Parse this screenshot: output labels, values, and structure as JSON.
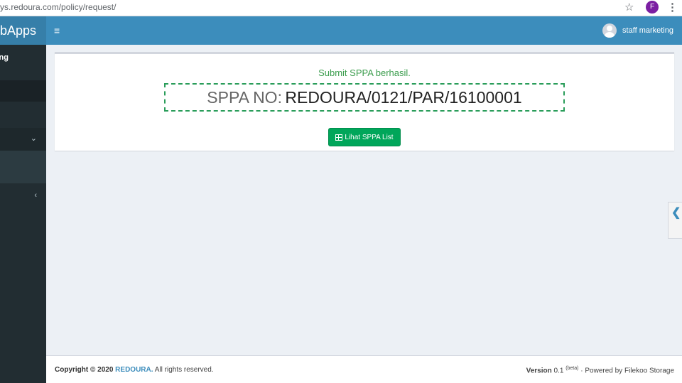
{
  "browser": {
    "url": "ys.redoura.com/policy/request/",
    "star_icon": "☆",
    "profile_initial": "F",
    "menu_icon": "⋮"
  },
  "sidebar": {
    "logo": "ebApps",
    "user_label": "ng",
    "expand_chevron": "⌄",
    "collapse_chevron": "‹"
  },
  "header": {
    "menu_icon": "≡",
    "user_name": "staff marketing"
  },
  "main": {
    "success_message": "Submit SPPA berhasil.",
    "sppa_label": "SPPA NO:",
    "sppa_number": "REDOURA/0121/PAR/16100001",
    "list_button_label": "Lihat SPPA List",
    "side_tab_icon": "❮"
  },
  "footer": {
    "copyright_prefix": "Copyright © 2020",
    "brand": "REDOURA.",
    "rights": "All rights reserved.",
    "version_label": "Version",
    "version_number": "0.1",
    "version_tag": "(beta)",
    "powered_by": "· Powered by Filekoo Storage"
  },
  "colors": {
    "header_blue": "#3c8dbc",
    "logo_blue": "#367fa9",
    "sidebar_dark": "#222d32",
    "success_green": "#00a65a",
    "content_bg": "#ecf0f5"
  }
}
